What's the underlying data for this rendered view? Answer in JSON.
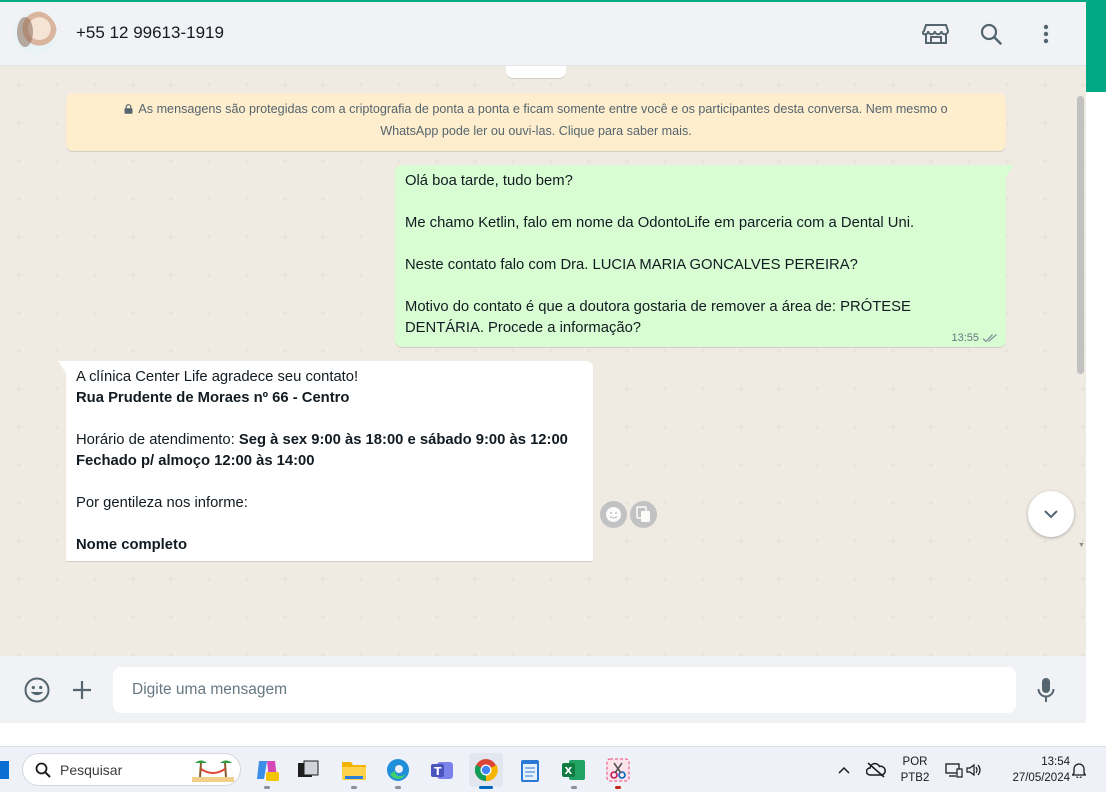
{
  "header": {
    "contact_name": "+55 12 99613-1919",
    "icons": [
      "catalog-icon",
      "search-icon",
      "menu-dots-icon"
    ]
  },
  "chat": {
    "encryption_notice_line1": "As mensagens são protegidas com a criptografia de ponta a ponta e ficam somente entre você e os participantes desta conversa. Nem mesmo o",
    "encryption_notice_line2": "WhatsApp pode ler ou ouvi-las. Clique para saber mais.",
    "outgoing": {
      "line1": "Olá boa tarde, tudo bem?",
      "line2": "Me chamo Ketlin, falo em nome da OdontoLife em parceria com a Dental Uni.",
      "line3": "Neste contato falo com Dra. LUCIA MARIA GONCALVES PEREIRA?",
      "line4a": "Motivo do contato é que a doutora gostaria de remover a área de: PRÓTESE",
      "line4b": "DENTÁRIA. Procede a informação?",
      "time": "13:55",
      "status": "delivered-double-check"
    },
    "incoming": {
      "line1": "A clínica Center Life agradece seu contato!",
      "line2_bold": "Rua Prudente de Moraes nº 66 - Centro",
      "line3_prefix": "Horário de atendimento: ",
      "line3_bold": "Seg à sex 9:00 às 18:00 e sábado 9:00 às 12:00",
      "line4_bold": "Fechado p/ almoço 12:00 às 14:00",
      "line5": "Por gentileza nos informe:",
      "line6_bold": "Nome completo"
    }
  },
  "footer": {
    "input_placeholder": "Digite uma mensagem"
  },
  "taskbar": {
    "search_label": "Pesquisar",
    "language_top": "POR",
    "language_bottom": "PTB2",
    "time": "13:54",
    "date": "27/05/2024",
    "colors": {
      "accent": "#00a884",
      "outgoing_bubble": "#d9fdd3",
      "notice": "#ffeecd"
    }
  }
}
